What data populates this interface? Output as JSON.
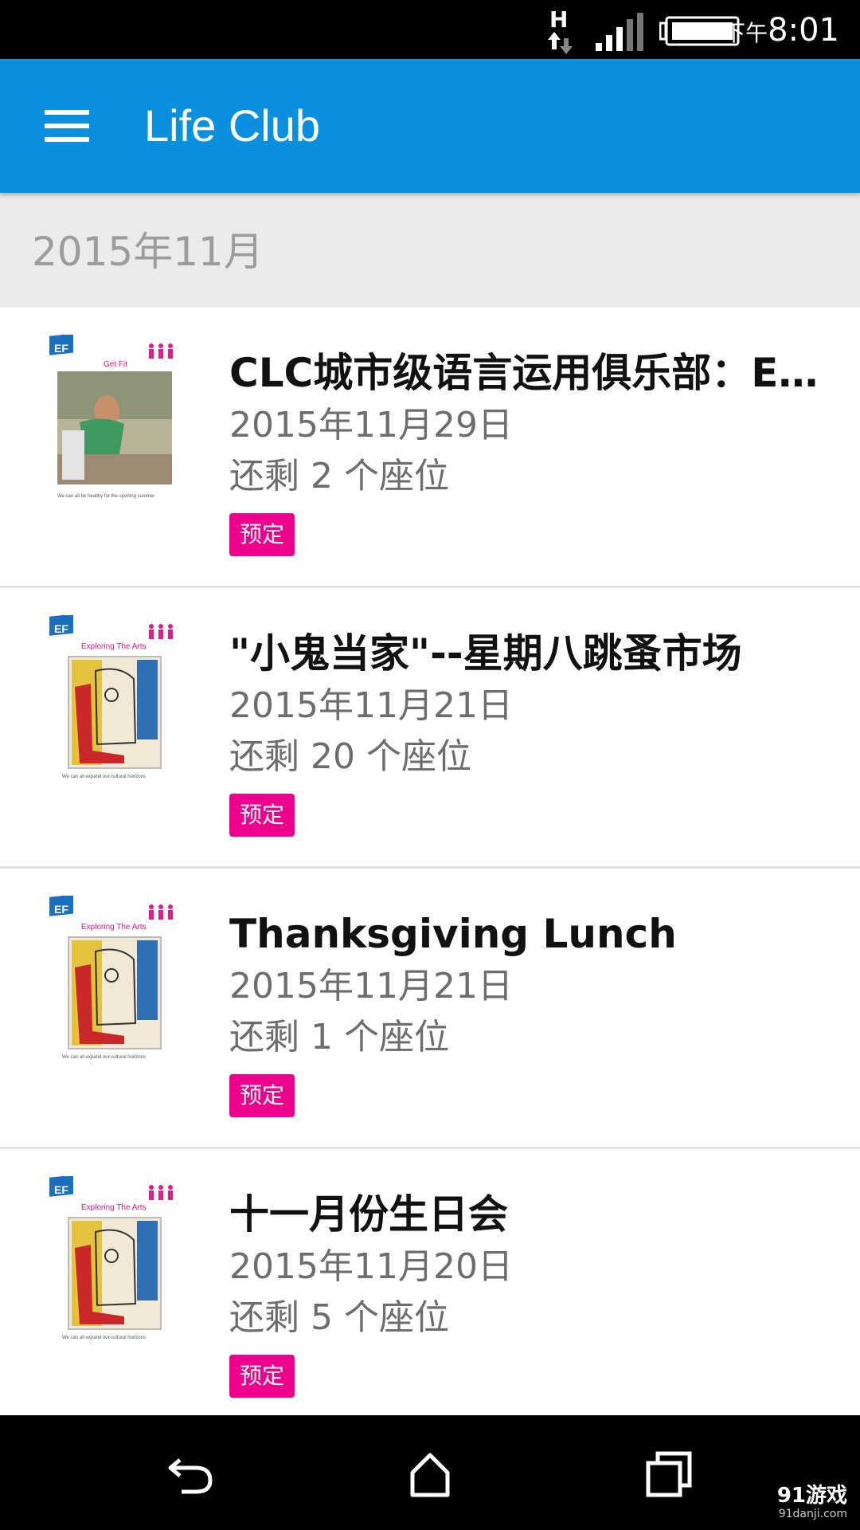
{
  "status_bar": {
    "network_type": "H",
    "time_prefix": "下午",
    "time": "8:01",
    "icons": [
      "network-h-icon",
      "signal-icon",
      "battery-icon"
    ]
  },
  "app_bar": {
    "title": "Life Club",
    "menu_icon": "hamburger-menu-icon"
  },
  "month_header": "2015年11月",
  "events": [
    {
      "title": "CLC城市级语言运用俱乐部：EF…",
      "date": "2015年11月29日",
      "seats": "还剩 2 个座位",
      "book_label": "预定",
      "poster": {
        "brand": "EF",
        "caption": "Get Fit",
        "footer": "We can all be healthy for the sporting summer"
      }
    },
    {
      "title": "\"小鬼当家\"--星期八跳蚤市场",
      "date": "2015年11月21日",
      "seats": "还剩 20 个座位",
      "book_label": "预定",
      "poster": {
        "brand": "EF",
        "caption": "Exploring The Arts",
        "footer": "We can all expand our cultural horizons"
      }
    },
    {
      "title": "Thanksgiving Lunch",
      "date": "2015年11月21日",
      "seats": "还剩 1 个座位",
      "book_label": "预定",
      "poster": {
        "brand": "EF",
        "caption": "Exploring The Arts",
        "footer": "We can all expand our cultural horizons"
      }
    },
    {
      "title": "十一月份生日会",
      "date": "2015年11月20日",
      "seats": "还剩 5 个座位",
      "book_label": "预定",
      "poster": {
        "brand": "EF",
        "caption": "Exploring The Arts",
        "footer": "We can all expand our cultural horizons"
      }
    }
  ],
  "nav_bar": {
    "buttons": [
      "back-icon",
      "home-icon",
      "recents-icon"
    ],
    "watermark": "91游戏",
    "watermark_url": "91danji.com"
  },
  "colors": {
    "app_bar": "#0a90de",
    "book_button": "#ec008c",
    "month_header_bg": "#ebebeb"
  }
}
